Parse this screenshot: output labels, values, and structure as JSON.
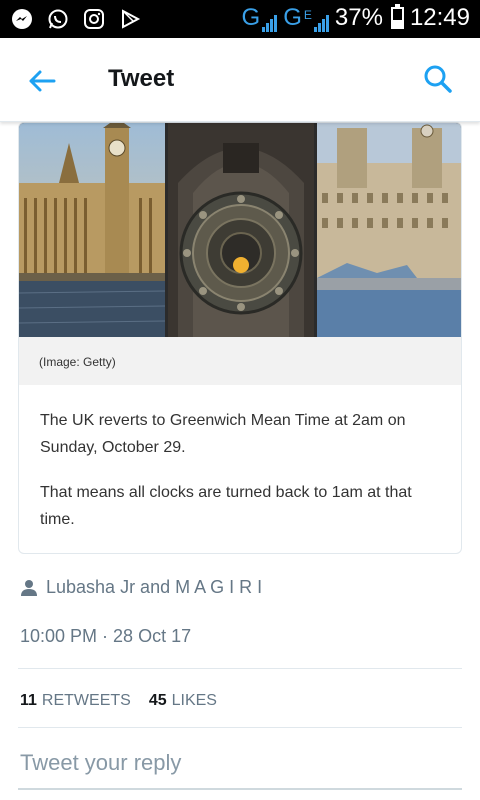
{
  "status_bar": {
    "network_label": "G",
    "network_label_2": "G",
    "network_sup": "E",
    "battery": "37%",
    "battery_level": 0.37,
    "time": "12:49",
    "icons": [
      "messenger-icon",
      "whatsapp-icon",
      "instagram-icon",
      "play-store-icon"
    ]
  },
  "app_bar": {
    "title": "Tweet",
    "back_icon": "arrow-left-icon",
    "search_icon": "search-icon",
    "accent_color": "#1da1f2"
  },
  "card": {
    "image_caption": "(Image: Getty)",
    "paragraphs": [
      "The UK reverts to Greenwich Mean Time at 2am on Sunday, October 29.",
      "That means all clocks are turned back to 1am at that time."
    ]
  },
  "social_context": {
    "icon": "person-icon",
    "text": "Lubasha Jr and M A G I R I"
  },
  "timestamp": "10:00 PM · 28 Oct 17",
  "stats": {
    "retweets_count": "11",
    "retweets_label": "RETWEETS",
    "likes_count": "45",
    "likes_label": "LIKES"
  },
  "reply": {
    "placeholder": "Tweet your reply"
  }
}
